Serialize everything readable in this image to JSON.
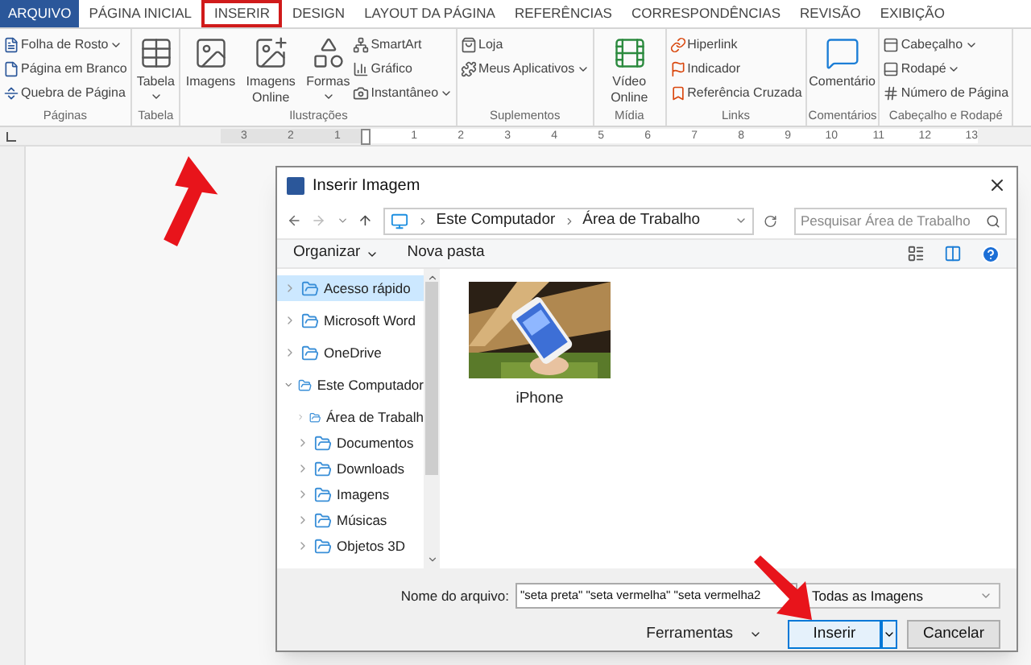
{
  "ribbon": {
    "tabs": [
      {
        "label": "ARQUIVO",
        "kind": "file",
        "selected": false
      },
      {
        "label": "PÁGINA INICIAL",
        "kind": "tab",
        "selected": false
      },
      {
        "label": "INSERIR",
        "kind": "tab",
        "selected": true
      },
      {
        "label": "DESIGN",
        "kind": "tab",
        "selected": false
      },
      {
        "label": "LAYOUT DA PÁGINA",
        "kind": "tab",
        "selected": false
      },
      {
        "label": "REFERÊNCIAS",
        "kind": "tab",
        "selected": false
      },
      {
        "label": "CORRESPONDÊNCIAS",
        "kind": "tab",
        "selected": false
      },
      {
        "label": "REVISÃO",
        "kind": "tab",
        "selected": false
      },
      {
        "label": "EXIBIÇÃO",
        "kind": "tab",
        "selected": false
      }
    ],
    "groups": [
      {
        "label": "Páginas",
        "items": [
          {
            "kind": "small",
            "label": "Folha de Rosto",
            "dropdown": true
          },
          {
            "kind": "small",
            "label": "Página em Branco",
            "dropdown": false
          },
          {
            "kind": "small",
            "label": "Quebra de Página",
            "dropdown": false
          }
        ]
      },
      {
        "label": "Tabela",
        "items": [
          {
            "kind": "large",
            "label": "Tabela",
            "dropdown": true
          }
        ]
      },
      {
        "label": "Ilustrações",
        "items": [
          {
            "kind": "large",
            "label": "Imagens",
            "dropdown": false
          },
          {
            "kind": "large",
            "label": "Imagens Online",
            "dropdown": false
          },
          {
            "kind": "large",
            "label": "Formas",
            "dropdown": true
          },
          {
            "kind": "small",
            "label": "SmartArt",
            "dropdown": false
          },
          {
            "kind": "small",
            "label": "Gráfico",
            "dropdown": false
          },
          {
            "kind": "small",
            "label": "Instantâneo",
            "dropdown": true
          }
        ]
      },
      {
        "label": "Suplementos",
        "items": [
          {
            "kind": "small",
            "label": "Loja",
            "dropdown": false
          },
          {
            "kind": "small",
            "label": "Meus Aplicativos",
            "dropdown": true
          }
        ]
      },
      {
        "label": "Mídia",
        "items": [
          {
            "kind": "large",
            "label": "Vídeo Online",
            "dropdown": false
          }
        ]
      },
      {
        "label": "Links",
        "items": [
          {
            "kind": "small",
            "label": "Hiperlink",
            "dropdown": false
          },
          {
            "kind": "small",
            "label": "Indicador",
            "dropdown": false
          },
          {
            "kind": "small",
            "label": "Referência Cruzada",
            "dropdown": false
          }
        ]
      },
      {
        "label": "Comentários",
        "items": [
          {
            "kind": "large",
            "label": "Comentário",
            "dropdown": false
          }
        ]
      },
      {
        "label": "Cabeçalho e Rodapé",
        "items": [
          {
            "kind": "small",
            "label": "Cabeçalho",
            "dropdown": true
          },
          {
            "kind": "small",
            "label": "Rodapé",
            "dropdown": true
          },
          {
            "kind": "small",
            "label": "Número de Página",
            "dropdown": false
          }
        ]
      }
    ]
  },
  "ruler": {
    "left_labels": [
      "3",
      "2",
      "1"
    ],
    "right_labels": [
      "1",
      "2",
      "3",
      "4",
      "5",
      "6",
      "7",
      "8",
      "9",
      "10",
      "11",
      "12",
      "13"
    ]
  },
  "dialog": {
    "title": "Inserir Imagem",
    "breadcrumb": [
      "Este Computador",
      "Área de Trabalho"
    ],
    "search": {
      "placeholder": "Pesquisar Área de Trabalho"
    },
    "toolbar": {
      "organize": "Organizar",
      "new_folder": "Nova pasta"
    },
    "nav": [
      {
        "label": "Acesso rápido",
        "selected": true,
        "expanded": false
      },
      {
        "label": "Microsoft Word",
        "selected": false,
        "expanded": false
      },
      {
        "label": "OneDrive",
        "selected": false,
        "expanded": false
      },
      {
        "label": "Este Computador",
        "selected": false,
        "expanded": true,
        "children": [
          {
            "label": "Área de Trabalh",
            "selected": false,
            "expanded": false
          },
          {
            "label": "Documentos",
            "selected": false,
            "expanded": false
          },
          {
            "label": "Downloads",
            "selected": false,
            "expanded": false
          },
          {
            "label": "Imagens",
            "selected": false,
            "expanded": false
          },
          {
            "label": "Músicas",
            "selected": false,
            "expanded": false
          },
          {
            "label": "Objetos 3D",
            "selected": false,
            "expanded": false
          }
        ]
      }
    ],
    "files": [
      {
        "name": "iPhone",
        "kind": "picture"
      }
    ],
    "filename_label": "Nome do arquivo:",
    "filename": "\"seta preta\" \"seta vermelha\" \"seta vermelha2",
    "filetype": "Todas as Imagens",
    "tools": "Ferramentas",
    "insert": "Inserir",
    "cancel": "Cancelar"
  }
}
